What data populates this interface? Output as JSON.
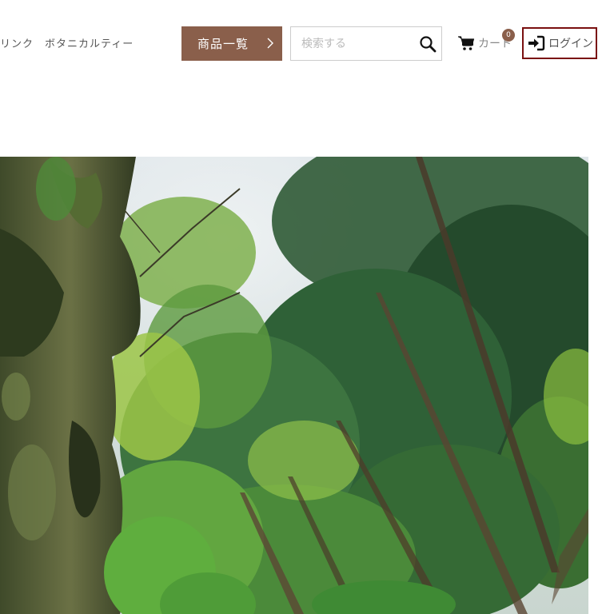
{
  "nav": {
    "links": [
      "リンク",
      "ボタニカルティー"
    ]
  },
  "products_button": {
    "label": "商品一覧",
    "icon": "chevron-right-icon"
  },
  "search": {
    "placeholder": "検索する",
    "value": "",
    "icon": "search-icon"
  },
  "cart": {
    "label": "カート",
    "count": "0",
    "icon": "cart-icon"
  },
  "login": {
    "label": "ログイン",
    "icon": "sign-in-icon"
  },
  "colors": {
    "accent": "#8a5f4b",
    "login_border": "#7a1010",
    "text": "#555555"
  },
  "hero": {
    "icon": "forest-photo"
  }
}
